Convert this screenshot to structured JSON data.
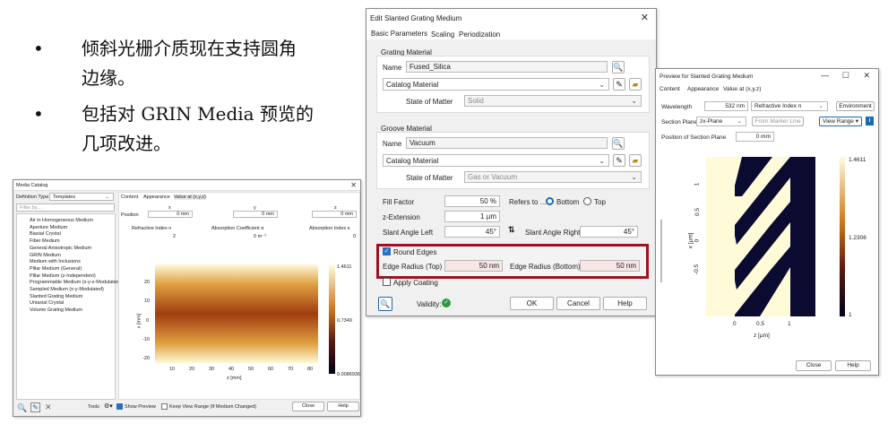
{
  "slide": {
    "bullets": [
      {
        "line1": "倾斜光栅介质现在支持圆角",
        "line2": "边缘。"
      },
      {
        "line1": "包括对 GRIN Media 预览的",
        "line2": "几项改进。"
      }
    ],
    "bullet_char": "•"
  },
  "catalog": {
    "title": "Media Catalog",
    "def_type_label": "Definition Type",
    "def_type_value": "Templates",
    "filter_placeholder": "Filter by...",
    "tree_items": [
      "Air in Homogeneous Medium",
      "Aperture Medium",
      "Biaxial Crystal",
      "Fiber Medium",
      "General Anisotropic Medium",
      "GRIN Medium",
      "Medium with Inclusions",
      "Pillar Medium (General)",
      "Pillar Medium (z-Independent)",
      "Programmable Medium (x-y-z-Modulated)",
      "Sampled Medium (x-y-Modulated)",
      "Slanted Grating Medium",
      "Uniaxial Crystal",
      "Volume Grating Medium"
    ],
    "tabs": [
      "Content",
      "Appearance",
      "Value at (x,y,z)"
    ],
    "coord_headers": [
      "x",
      "y",
      "z"
    ],
    "position_label": "Position",
    "position_values": [
      "0 mm",
      "0 mm",
      "0 mm"
    ],
    "value_headers": [
      "Refractive Index n",
      "Absorption Coefficient α",
      "Absorption Index κ"
    ],
    "value_values": [
      "2",
      "0 m⁻¹",
      "0"
    ],
    "plot": {
      "xlabel": "z [mm]",
      "ylabel": "x [mm]",
      "xticks": [
        "10",
        "20",
        "30",
        "40",
        "50",
        "60",
        "70",
        "80"
      ],
      "yticks": [
        "20",
        "10",
        "0",
        "-10",
        "-20"
      ],
      "colorbar": [
        "1.4611",
        "0.7349",
        "0.0086936"
      ]
    },
    "tools_label": "Tools",
    "show_preview_label": "Show Preview",
    "keep_view_label": "Keep View Range (If Medium Changed)",
    "close_label": "Close",
    "help_label": "Help"
  },
  "edit": {
    "title": "Edit Slanted Grating Medium",
    "tabs": [
      "Basic Parameters",
      "Scaling",
      "Periodization"
    ],
    "grating_group": "Grating Material",
    "name_label": "Name",
    "grating_name": "Fused_Silica",
    "catalog_label": "Catalog Material",
    "state_label": "State of Matter",
    "grating_state": "Solid",
    "groove_group": "Groove Material",
    "groove_name": "Vacuum",
    "groove_state": "Gas or Vacuum",
    "fill_factor_label": "Fill Factor",
    "fill_factor": "50 %",
    "refers_label": "Refers to ...",
    "bottom_label": "Bottom",
    "top_label": "Top",
    "zext_label": "z-Extension",
    "zext": "1 µm",
    "slant_left_label": "Slant Angle Left",
    "slant_left": "45°",
    "slant_right_label": "Slant Angle Right",
    "slant_right": "45°",
    "round_edges_label": "Round Edges",
    "edge_top_label": "Edge Radius (Top)",
    "edge_top": "50 nm",
    "edge_bottom_label": "Edge Radius (Bottom)",
    "edge_bottom": "50 nm",
    "apply_coating_label": "Apply Coating",
    "validity_label": "Validity:",
    "ok_label": "OK",
    "cancel_label": "Cancel",
    "help_label": "Help",
    "highlight_color": "#a01020"
  },
  "preview": {
    "title": "Preview for Slanted Grating Medium",
    "tabs": [
      "Content",
      "Appearance",
      "Value at (x,y,z)"
    ],
    "wavelength_label": "Wavelength",
    "wavelength": "532 nm",
    "quantity": "Refractive Index n",
    "environment_label": "Environment",
    "section_plane_label": "Section Plane",
    "section_plane": "zx-Plane",
    "from_marker_label": "From Marker Line",
    "view_range_label": "View Range",
    "position_label": "Position of Section Plane",
    "position": "0 mm",
    "plot": {
      "xlabel": "z [µm]",
      "ylabel": "x [µm]",
      "xticks": [
        "0",
        "0.5",
        "1"
      ],
      "yticks": [
        "1",
        "0.5",
        "0",
        "-0.5"
      ],
      "colorbar": [
        "1.4611",
        "1.2306",
        "1"
      ]
    },
    "close_label": "Close",
    "help_label": "Help"
  }
}
